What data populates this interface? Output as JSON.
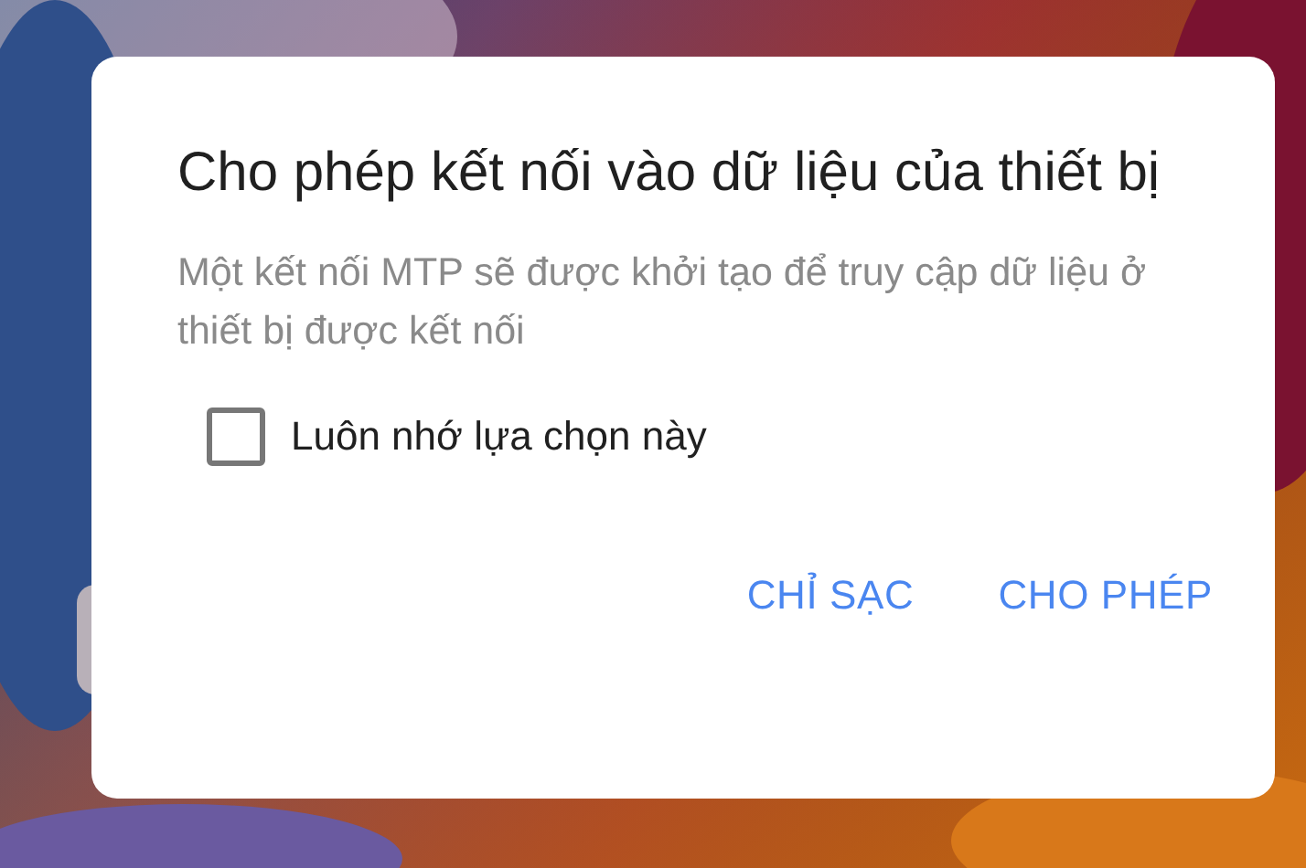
{
  "dialog": {
    "title": "Cho phép kết nối vào dữ liệu của thiết bị",
    "message": "Một kết nối MTP sẽ được khởi tạo để truy cập dữ liệu ở thiết bị được kết nối",
    "checkbox": {
      "label": "Luôn nhớ lựa chọn này",
      "checked": false
    },
    "buttons": [
      {
        "label": "CHỈ SẠC"
      },
      {
        "label": "CHO PHÉP"
      }
    ]
  }
}
